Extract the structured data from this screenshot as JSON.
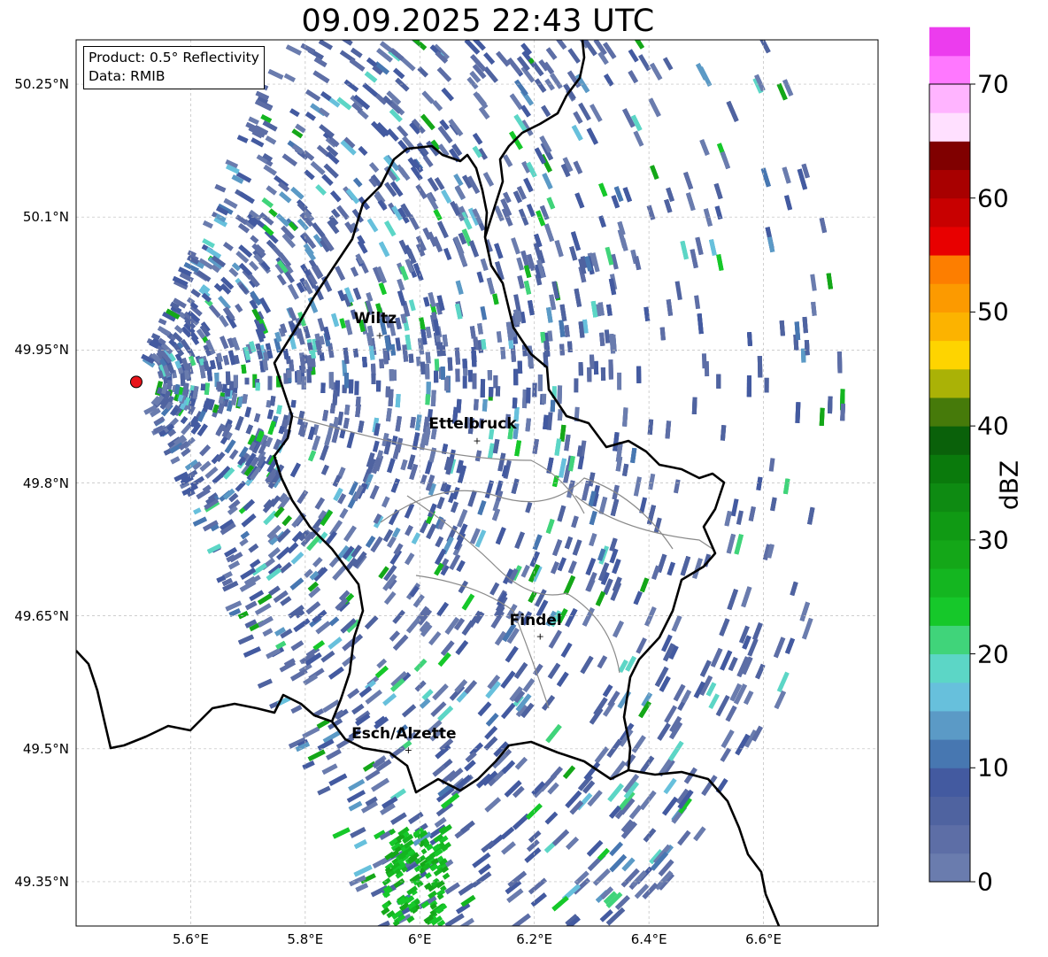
{
  "title": "09.09.2025 22:43 UTC",
  "info": {
    "product": "Product: 0.5° Reflectivity",
    "data_source": "Data: RMIB"
  },
  "map": {
    "lon_range": [
      5.4,
      6.8
    ],
    "lat_range": [
      49.3,
      50.3
    ],
    "latitude_labels": [
      {
        "lat": 50.25,
        "text": "50.25°N"
      },
      {
        "lat": 50.1,
        "text": "50.1°N"
      },
      {
        "lat": 49.95,
        "text": "49.95°N"
      },
      {
        "lat": 49.8,
        "text": "49.8°N"
      },
      {
        "lat": 49.65,
        "text": "49.65°N"
      },
      {
        "lat": 49.5,
        "text": "49.5°N"
      },
      {
        "lat": 49.35,
        "text": "49.35°N"
      }
    ],
    "longitude_labels": [
      {
        "lon": 5.6,
        "text": "5.6°E"
      },
      {
        "lon": 5.8,
        "text": "5.8°E"
      },
      {
        "lon": 6.0,
        "text": "6°E"
      },
      {
        "lon": 6.2,
        "text": "6.2°E"
      },
      {
        "lon": 6.4,
        "text": "6.4°E"
      },
      {
        "lon": 6.6,
        "text": "6.6°E"
      }
    ],
    "cities": [
      {
        "name": "Wiltz",
        "lon": 5.93,
        "lat": 49.967
      },
      {
        "name": "Ettelbruck",
        "lon": 6.1,
        "lat": 49.848
      },
      {
        "name": "Findel",
        "lon": 6.21,
        "lat": 49.627
      },
      {
        "name": "Esch/Alzette",
        "lon": 5.98,
        "lat": 49.499
      }
    ],
    "radar_site": {
      "lon": 5.505,
      "lat": 49.914,
      "marker_color": "#e8141b"
    },
    "border_color": "#000000",
    "canton_border_color": "#8a8a8a",
    "grid_color": "#bdbdbd"
  },
  "colorbar": {
    "label": "dBZ",
    "min": 0,
    "max": 70,
    "step": 2.5,
    "ticks": [
      {
        "value": 0,
        "text": "0"
      },
      {
        "value": 10,
        "text": "10"
      },
      {
        "value": 20,
        "text": "20"
      },
      {
        "value": 30,
        "text": "30"
      },
      {
        "value": 40,
        "text": "40"
      },
      {
        "value": 50,
        "text": "50"
      },
      {
        "value": 60,
        "text": "60"
      },
      {
        "value": 70,
        "text": "70"
      }
    ],
    "colors": [
      "#6a7cae",
      "#5d6ea6",
      "#4f63a0",
      "#435aa0",
      "#4777b1",
      "#5b9ac6",
      "#67c0dc",
      "#5cd6c6",
      "#40d47a",
      "#16c82a",
      "#14b620",
      "#14a718",
      "#109a14",
      "#0e8b12",
      "#0a7a0c",
      "#0a610a",
      "#467a0a",
      "#aab206",
      "#fed400",
      "#fcb300",
      "#fc9a00",
      "#fd7e00",
      "#e80000",
      "#c80000",
      "#a80000",
      "#800000",
      "#ffe0ff",
      "#ffb4ff",
      "#ff78ff",
      "#ec3cee"
    ]
  }
}
